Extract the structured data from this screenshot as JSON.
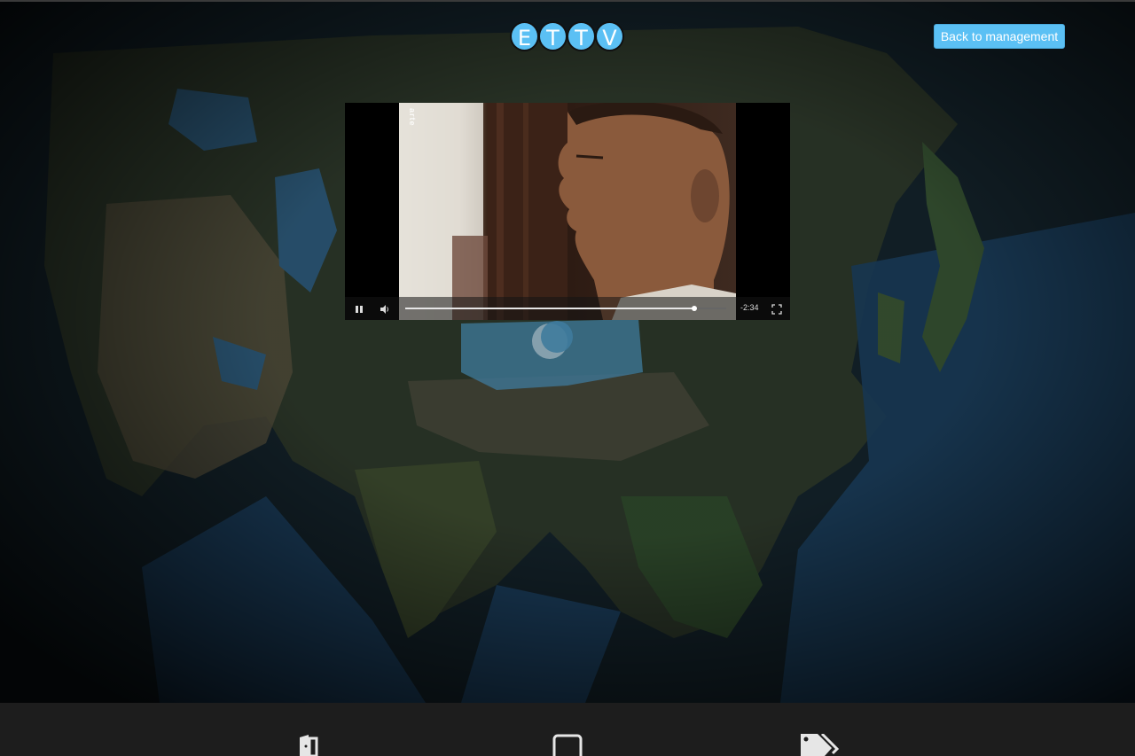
{
  "header": {
    "logo_letters": [
      "E",
      "T",
      "T",
      "V"
    ],
    "back_button_label": "Back to management",
    "accent_color": "#5bc0f4"
  },
  "video": {
    "watermark": "arte",
    "time_remaining": "-2:34",
    "progress": 0.9,
    "playing": true,
    "controls": [
      "pause-icon",
      "volume-icon",
      "fullscreen-icon"
    ]
  },
  "bottom_bar": {
    "icons": [
      "door-exit-icon",
      "tablet-icon",
      "tags-icon"
    ]
  }
}
